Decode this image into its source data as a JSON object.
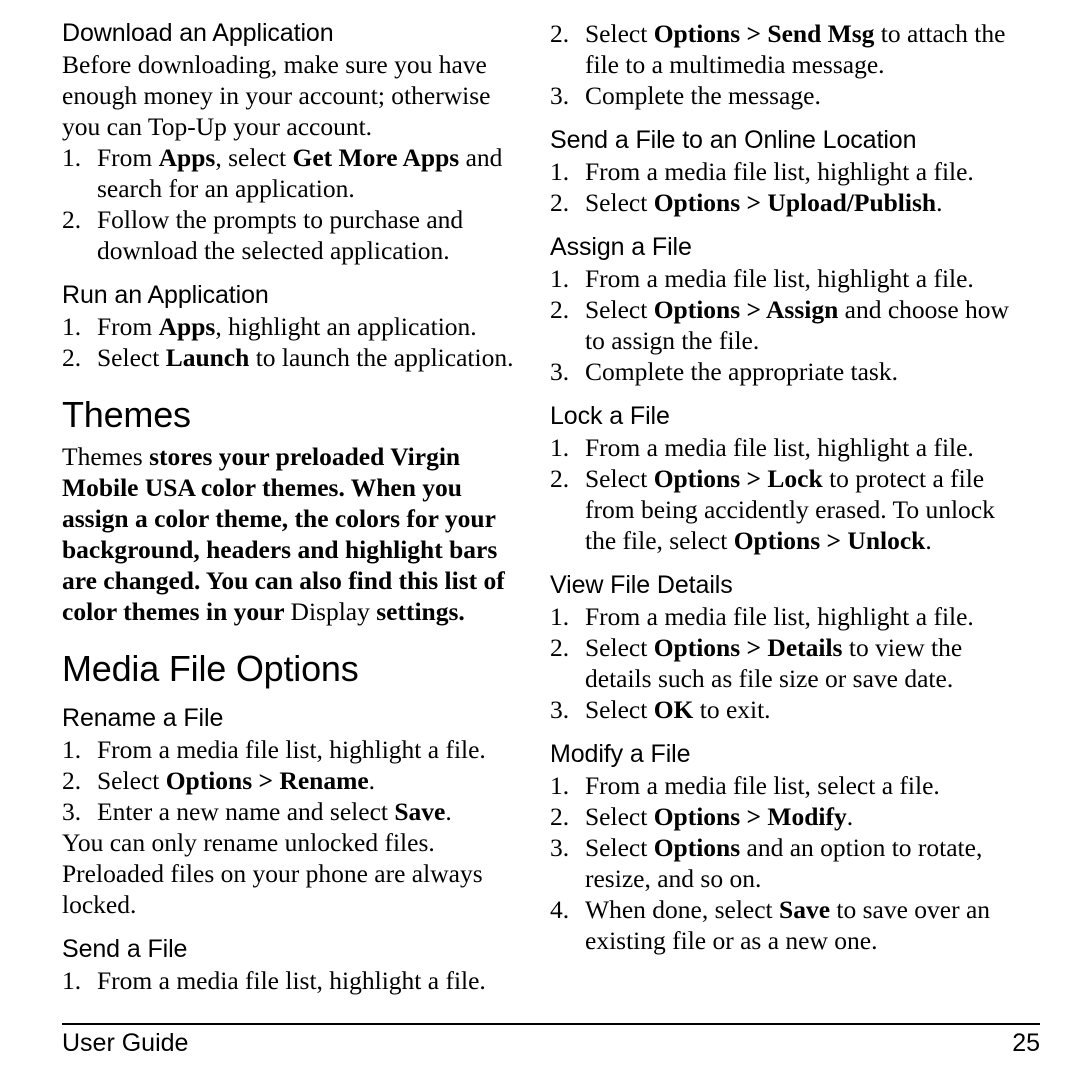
{
  "document": {
    "footer": {
      "left_label": "User Guide",
      "page_number": "25"
    }
  },
  "left_column": {
    "sections": [
      {
        "heading": "Download an Application",
        "heading_level": "sub",
        "intro": "Before downloading, make sure you have enough money in your account; otherwise you can Top-Up your account.",
        "steps": [
          {
            "num": "1.",
            "text_parts": [
              "From ",
              "Apps",
              ", select ",
              "Get More Apps",
              " and search for an application."
            ]
          },
          {
            "num": "2.",
            "text_parts": [
              "Follow the prompts to purchase and download the selected application."
            ]
          }
        ]
      },
      {
        "heading": "Run an Application",
        "heading_level": "sub",
        "steps": [
          {
            "num": "1.",
            "text_parts": [
              "From ",
              "Apps",
              ", highlight an application."
            ]
          },
          {
            "num": "2.",
            "text_parts": [
              "Select ",
              "Launch",
              " to launch the application."
            ]
          }
        ]
      },
      {
        "heading": "Themes",
        "heading_level": "section",
        "body_parts": [
          "Themes",
          " stores your preloaded Virgin Mobile USA color themes. When you assign a color theme, the colors for your background, headers and highlight bars are changed. You can also find this list of color themes in your ",
          "Display",
          " settings."
        ]
      },
      {
        "heading": "Media File Options",
        "heading_level": "section"
      },
      {
        "heading": "Rename a File",
        "heading_level": "sub",
        "steps": [
          {
            "num": "1.",
            "text_parts": [
              "From a media file list, highlight a file."
            ]
          },
          {
            "num": "2.",
            "text_parts": [
              "Select ",
              "Options > Rename",
              "."
            ]
          },
          {
            "num": "3.",
            "text_parts": [
              "Enter a new name and select ",
              "Save",
              "."
            ]
          }
        ],
        "note": "You can only rename unlocked files. Preloaded files on your phone are always locked."
      },
      {
        "heading": "Send a File",
        "heading_level": "sub",
        "steps": [
          {
            "num": "1.",
            "text_parts": [
              "From a media file list, highlight a file."
            ]
          }
        ]
      }
    ]
  },
  "right_column": {
    "continued_steps": [
      {
        "num": "2.",
        "text_parts": [
          "Select ",
          "Options > Send Msg",
          " to attach the file to a multimedia message."
        ]
      },
      {
        "num": "3.",
        "text_parts": [
          "Complete the message."
        ]
      }
    ],
    "sections": [
      {
        "heading": "Send a File to an Online Location",
        "heading_level": "sub",
        "steps": [
          {
            "num": "1.",
            "text_parts": [
              "From a media file list, highlight a file."
            ]
          },
          {
            "num": "2.",
            "text_parts": [
              "Select ",
              "Options > Upload/Publish",
              "."
            ]
          }
        ]
      },
      {
        "heading": "Assign a File",
        "heading_level": "sub",
        "steps": [
          {
            "num": "1.",
            "text_parts": [
              "From a media file list, highlight a file."
            ]
          },
          {
            "num": "2.",
            "text_parts": [
              "Select ",
              "Options > Assign",
              " and choose how to assign the file."
            ]
          },
          {
            "num": "3.",
            "text_parts": [
              "Complete the appropriate task."
            ]
          }
        ]
      },
      {
        "heading": "Lock a File",
        "heading_level": "sub",
        "steps": [
          {
            "num": "1.",
            "text_parts": [
              "From a media file list, highlight a file."
            ]
          },
          {
            "num": "2.",
            "text_parts": [
              "Select ",
              "Options > Lock",
              " to protect a file from being accidently erased. To unlock the file, select ",
              "Options > Unlock",
              "."
            ]
          }
        ]
      },
      {
        "heading": "View File Details",
        "heading_level": "sub",
        "steps": [
          {
            "num": "1.",
            "text_parts": [
              "From a media file list, highlight a file."
            ]
          },
          {
            "num": "2.",
            "text_parts": [
              "Select ",
              "Options > Details",
              " to view the details such as file size or save date."
            ]
          },
          {
            "num": "3.",
            "text_parts": [
              "Select ",
              "OK",
              " to exit."
            ]
          }
        ]
      },
      {
        "heading": "Modify a File",
        "heading_level": "sub",
        "steps": [
          {
            "num": "1.",
            "text_parts": [
              "From a media file list, select a file."
            ]
          },
          {
            "num": "2.",
            "text_parts": [
              "Select ",
              "Options > Modify",
              "."
            ]
          },
          {
            "num": "3.",
            "text_parts": [
              "Select ",
              "Options",
              " and an option to rotate, resize, and so on."
            ]
          },
          {
            "num": "4.",
            "text_parts": [
              "When done, select ",
              "Save",
              " to save over an existing file or as a new one."
            ]
          }
        ]
      }
    ]
  }
}
